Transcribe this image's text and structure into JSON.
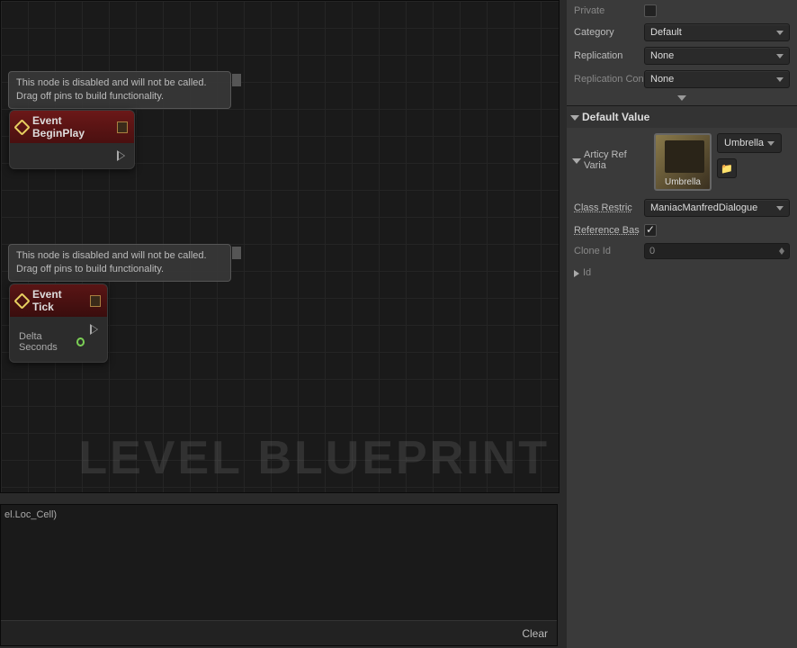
{
  "graph": {
    "watermark": "LEVEL BLUEPRINT",
    "tooltips": {
      "beginplay": "This node is disabled and will not be called.\nDrag off pins to build functionality.",
      "tick": "This node is disabled and will not be called.\nDrag off pins to build functionality."
    },
    "nodes": {
      "beginplay_title": "Event BeginPlay",
      "tick_title": "Event Tick",
      "delta_seconds": "Delta Seconds"
    }
  },
  "log": {
    "line": "el.Loc_Cell)",
    "clear": "Clear"
  },
  "props": {
    "private_label": "Private",
    "category_label": "Category",
    "category_value": "Default",
    "replication_label": "Replication",
    "replication_value": "None",
    "repcond_label": "Replication Con",
    "repcond_value": "None"
  },
  "section": {
    "default_value": "Default Value",
    "articy_ref": "Articy Ref Varia",
    "id": "Id"
  },
  "asset": {
    "thumb_label": "Umbrella",
    "dropdown": "Umbrella",
    "class_restrict_label": "Class Restric",
    "class_restrict_value": "ManiacManfredDialogue",
    "ref_base_label": "Reference Bas",
    "clone_id_label": "Clone Id",
    "clone_id_value": "0"
  }
}
